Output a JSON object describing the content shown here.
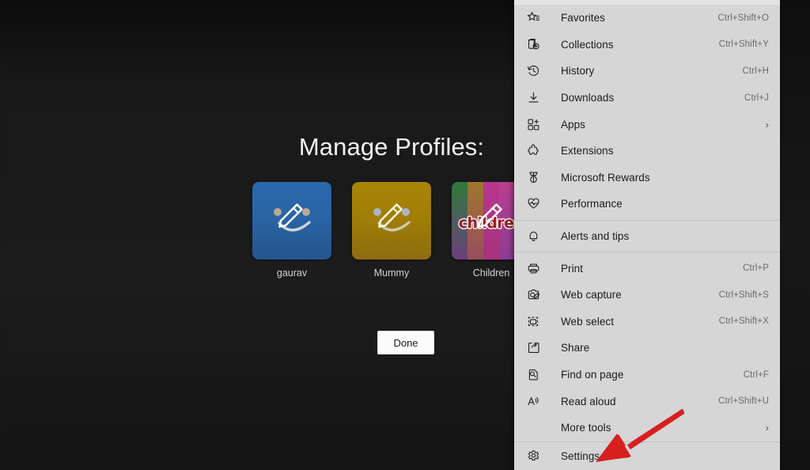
{
  "page": {
    "title": "Manage Profiles:",
    "done_label": "Done",
    "profiles": [
      {
        "name": "gaurav",
        "tile_style": "blue",
        "color": "#2a64a4",
        "avatar": "smiley-face",
        "edit_overlay": "pencil-icon"
      },
      {
        "name": "Mummy",
        "tile_style": "gold",
        "color": "#a07d07",
        "avatar": "smiley-face",
        "edit_overlay": "pencil-icon"
      },
      {
        "name": "Children",
        "tile_style": "stripes",
        "color": "#b7368f",
        "avatar": "children-word-art",
        "avatar_text": "children",
        "edit_overlay": "pencil-icon"
      }
    ]
  },
  "menu": {
    "items": [
      {
        "label": "Favorites",
        "shortcut": "Ctrl+Shift+O",
        "icon": "favorites-star-icon",
        "submenu": false
      },
      {
        "label": "Collections",
        "shortcut": "Ctrl+Shift+Y",
        "icon": "collections-icon",
        "submenu": false
      },
      {
        "label": "History",
        "shortcut": "Ctrl+H",
        "icon": "history-clock-icon",
        "submenu": false
      },
      {
        "label": "Downloads",
        "shortcut": "Ctrl+J",
        "icon": "downloads-icon",
        "submenu": false
      },
      {
        "label": "Apps",
        "shortcut": "",
        "icon": "apps-grid-icon",
        "submenu": true
      },
      {
        "label": "Extensions",
        "shortcut": "",
        "icon": "extensions-puzzle-icon",
        "submenu": false
      },
      {
        "label": "Microsoft Rewards",
        "shortcut": "",
        "icon": "rewards-medal-icon",
        "submenu": false
      },
      {
        "label": "Performance",
        "shortcut": "",
        "icon": "performance-heart-icon",
        "submenu": false
      },
      {
        "separator": true
      },
      {
        "label": "Alerts and tips",
        "shortcut": "",
        "icon": "bell-icon",
        "submenu": false
      },
      {
        "separator": true
      },
      {
        "label": "Print",
        "shortcut": "Ctrl+P",
        "icon": "printer-icon",
        "submenu": false
      },
      {
        "label": "Web capture",
        "shortcut": "Ctrl+Shift+S",
        "icon": "web-capture-icon",
        "submenu": false
      },
      {
        "label": "Web select",
        "shortcut": "Ctrl+Shift+X",
        "icon": "web-select-icon",
        "submenu": false
      },
      {
        "label": "Share",
        "shortcut": "",
        "icon": "share-icon",
        "submenu": false
      },
      {
        "label": "Find on page",
        "shortcut": "Ctrl+F",
        "icon": "find-on-page-icon",
        "submenu": false
      },
      {
        "label": "Read aloud",
        "shortcut": "Ctrl+Shift+U",
        "icon": "read-aloud-icon",
        "submenu": false
      },
      {
        "label": "More tools",
        "shortcut": "",
        "icon": "",
        "submenu": true
      }
    ],
    "settings": {
      "label": "Settings",
      "shortcut": "",
      "icon": "gear-icon"
    },
    "chevron_glyph": "›"
  },
  "annotation": {
    "type": "red-arrow",
    "points_to": "Settings",
    "color": "#d81f1f"
  },
  "colors": {
    "menu_background": "#d6d6d6",
    "menu_text": "#1a1a1a",
    "shortcut_text": "#6a6a6a",
    "page_background": "#171717",
    "page_text": "#f3f3f3",
    "done_button_background": "#fbfbfb",
    "arrow": "#d81f1f"
  }
}
